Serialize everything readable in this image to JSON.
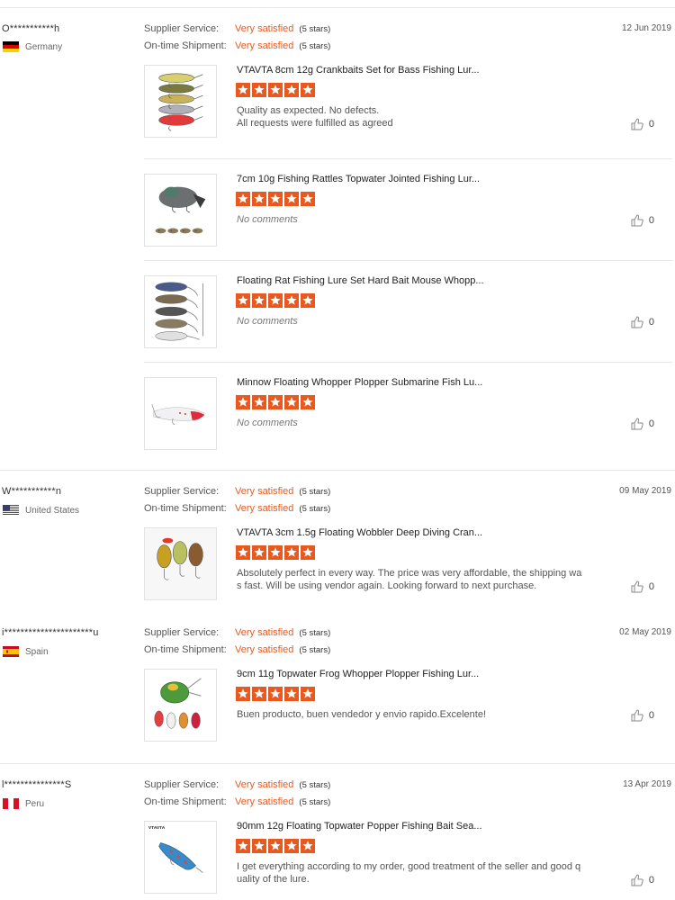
{
  "labels": {
    "supplier_service": "Supplier Service:",
    "ontime_shipment": "On-time Shipment:",
    "rating_text": "Very satisfied",
    "rating_stars": "(5 stars)"
  },
  "colors": {
    "accent": "#e9591f",
    "divider": "#e6e6e6"
  },
  "reviews": [
    {
      "buyer": "O***********h",
      "country": "Germany",
      "date": "12 Jun 2019",
      "items": [
        {
          "title": "VTAVTA 8cm 12g Crankbaits Set for Bass Fishing Lur...",
          "stars": 5,
          "feedback": "Quality as expected. No defects.\nAll requests were fulfilled as agreed",
          "likes": "0",
          "thumb": "crankbaits"
        },
        {
          "title": "7cm 10g Fishing Rattles Topwater Jointed Fishing Lur...",
          "stars": 5,
          "feedback": "No comments",
          "likes": "0",
          "thumb": "duck"
        },
        {
          "title": "Floating Rat Fishing Lure Set Hard Bait Mouse Whopp...",
          "stars": 5,
          "feedback": "No comments",
          "likes": "0",
          "thumb": "rats"
        },
        {
          "title": "Minnow Floating Whopper Plopper Submarine Fish Lu...",
          "stars": 5,
          "feedback": "No comments",
          "likes": "0",
          "thumb": "minnow"
        }
      ]
    },
    {
      "buyer": "W***********n",
      "country": "United States",
      "date": "09 May 2019",
      "items": [
        {
          "title": "VTAVTA 3cm 1.5g Floating Wobbler Deep Diving Cran...",
          "stars": 5,
          "feedback": "Absolutely perfect in every way. The price was very affordable, the shipping wa\ns fast. Will be using vendor again. Looking forward to next purchase.",
          "likes": "0",
          "thumb": "mini"
        }
      ]
    },
    {
      "buyer": "i**********************u",
      "country": "Spain",
      "date": "02 May 2019",
      "items": [
        {
          "title": "9cm 11g Topwater Frog Whopper Plopper Fishing Lur...",
          "stars": 5,
          "feedback": "Buen producto, buen vendedor y envio rapido.Excelente!",
          "likes": "0",
          "thumb": "frog"
        }
      ]
    },
    {
      "buyer": "l***************S",
      "country": "Peru",
      "date": "13 Apr 2019",
      "items": [
        {
          "title": "90mm 12g Floating Topwater Popper Fishing Bait Sea...",
          "stars": 5,
          "feedback": "I get everything according to my order, good treatment of the seller and good q\nuality of the lure.",
          "likes": "0",
          "thumb": "popper",
          "thumb_text": "VTAVTA"
        }
      ]
    }
  ]
}
